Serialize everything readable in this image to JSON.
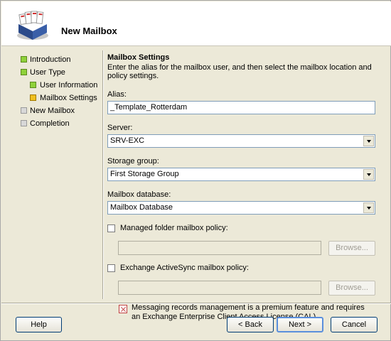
{
  "window": {
    "title": "New Mailbox",
    "header_icon": "mailbox-wizard-icon"
  },
  "nav": {
    "items": [
      {
        "label": "Introduction",
        "status": "complete",
        "level": 0
      },
      {
        "label": "User Type",
        "status": "complete",
        "level": 0
      },
      {
        "label": "User Information",
        "status": "complete",
        "level": 1
      },
      {
        "label": "Mailbox Settings",
        "status": "current",
        "level": 1
      },
      {
        "label": "New Mailbox",
        "status": "pending",
        "level": 0
      },
      {
        "label": "Completion",
        "status": "pending",
        "level": 0
      }
    ]
  },
  "content": {
    "title": "Mailbox Settings",
    "description": "Enter the alias for the mailbox user, and then select the mailbox location and policy settings.",
    "alias": {
      "label": "Alias:",
      "value": "_Template_Rotterdam"
    },
    "server": {
      "label": "Server:",
      "value": "SRV-EXC"
    },
    "storage_group": {
      "label": "Storage group:",
      "value": "First Storage Group"
    },
    "mailbox_database": {
      "label": "Mailbox database:",
      "value": "Mailbox Database"
    },
    "managed_folder": {
      "label": "Managed folder mailbox policy:",
      "checked": false,
      "browse": "Browse..."
    },
    "activesync": {
      "label": "Exchange ActiveSync mailbox policy:",
      "checked": false,
      "browse": "Browse..."
    },
    "note": "Messaging records management is a premium feature and requires an Exchange Enterprise Client Access License (CAL)."
  },
  "buttons": {
    "help": "Help",
    "back": "< Back",
    "next": "Next >",
    "cancel": "Cancel"
  },
  "colors": {
    "complete": "#8fd13a",
    "current": "#f0c020",
    "pending": "#d8d8d8",
    "dialog_bg": "#ece9d8"
  }
}
